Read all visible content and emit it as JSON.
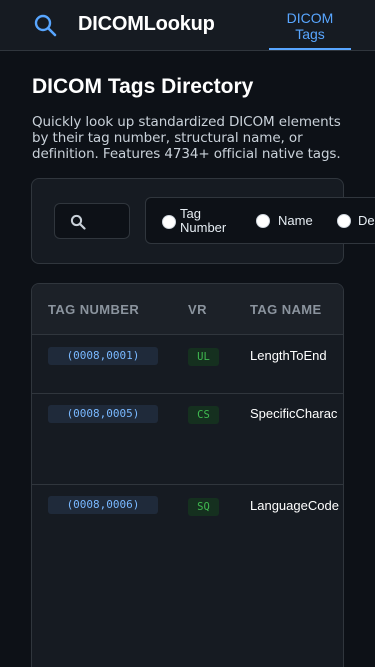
{
  "header": {
    "brand": "DICOMLookup",
    "nav_tab": "DICOM Tags"
  },
  "intro": {
    "title": "DICOM Tags Directory",
    "description": "Quickly look up standardized DICOM elements by their tag number, structural name, or definition. Features 4734+ official native tags."
  },
  "filters": {
    "search_placeholder": "",
    "options": [
      {
        "label": "Tag Number",
        "selected": false
      },
      {
        "label": "Name",
        "selected": false
      },
      {
        "label": "De",
        "selected": false
      }
    ]
  },
  "table": {
    "columns": [
      "TAG NUMBER",
      "VR",
      "TAG NAME"
    ],
    "rows": [
      {
        "tag": "(0008,0001)",
        "vr": "UL",
        "name": "LengthToEnd"
      },
      {
        "tag": "(0008,0005)",
        "vr": "CS",
        "name": "SpecificCharac"
      },
      {
        "tag": "(0008,0006)",
        "vr": "SQ",
        "name": "LanguageCode"
      }
    ]
  },
  "colors": {
    "accent": "#58a6ff",
    "background": "#0d1117",
    "surface": "#161b22",
    "vr_green": "#3fb950"
  },
  "icons": {
    "search": "search-icon",
    "radio": "radio-icon"
  }
}
